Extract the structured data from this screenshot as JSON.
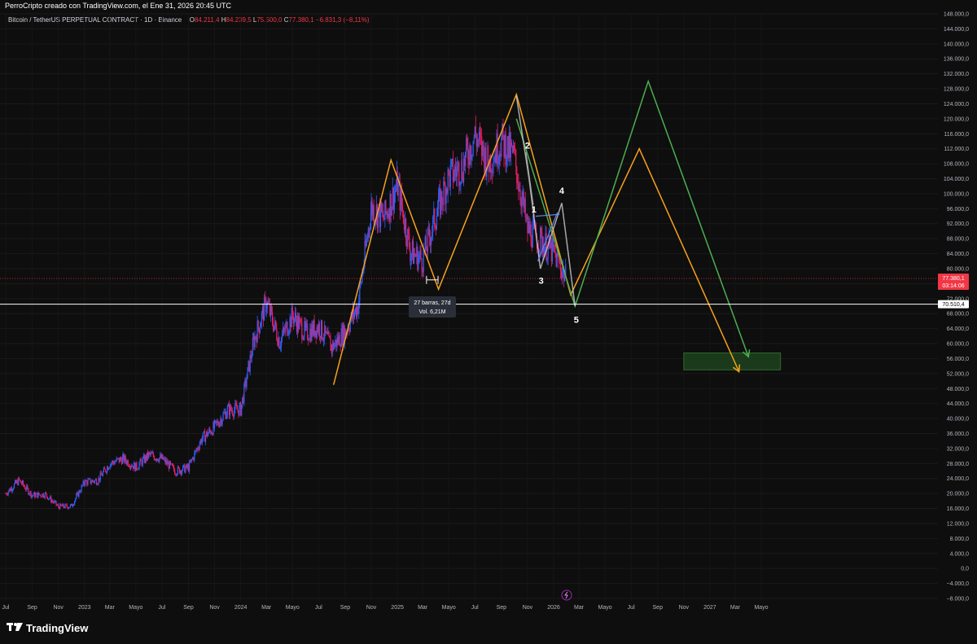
{
  "header": {
    "creator_text": "PerroCripto creado con TradingView.com, el Ene 31, 2026 20:45 UTC"
  },
  "legend": {
    "symbol": "Bitcoin / TetherUS PERPETUAL CONTRACT · 1D · Binance",
    "open_label": "O",
    "open": "84.211,4",
    "high_label": "H",
    "high": "84.239,5",
    "low_label": "L",
    "low": "75.500,0",
    "close_label": "C",
    "close": "77.380,1",
    "change": "−6.831,3 (−8,11%)"
  },
  "price_badge": {
    "price": "77.380,1",
    "countdown": "03:14:06",
    "color": "#f23645"
  },
  "line_badge": {
    "price": "70.510,4"
  },
  "range_tooltip": {
    "bars": "27 barras, 27d",
    "volume": "Vol. 6,21M"
  },
  "wave_labels": [
    "1",
    "2",
    "3",
    "4",
    "5"
  ],
  "brand": {
    "name": "TradingView"
  },
  "colors": {
    "background": "#0e0e0e",
    "candle_up": "#2962ff",
    "candle_down": "#e91e63",
    "orange_path": "#f7a21b",
    "green_path": "#4caf50",
    "target_zone": "#1b3a1b"
  },
  "chart_data": {
    "type": "candlestick",
    "title": "Bitcoin / TetherUS PERPETUAL CONTRACT · 1D · Binance",
    "ylim": [
      -8000,
      148000
    ],
    "y_ticks": [
      148000,
      144000,
      140000,
      136000,
      132000,
      128000,
      124000,
      120000,
      116000,
      112000,
      108000,
      104000,
      100000,
      96000,
      92000,
      88000,
      84000,
      80000,
      76000,
      72000,
      68000,
      64000,
      60000,
      56000,
      52000,
      48000,
      44000,
      40000,
      36000,
      32000,
      28000,
      24000,
      20000,
      16000,
      12000,
      8000,
      4000,
      0,
      -4000,
      -8000
    ],
    "y_tick_labels": [
      "148.000,0",
      "144.000,0",
      "140.000,0",
      "136.000,0",
      "132.000,0",
      "128.000,0",
      "124.000,0",
      "120.000,0",
      "116.000,0",
      "112.000,0",
      "108.000,0",
      "104.000,0",
      "100.000,0",
      "96.000,0",
      "92.000,0",
      "88.000,0",
      "84.000,0",
      "80.000,0",
      "76.000,0",
      "72.000,0",
      "68.000,0",
      "64.000,0",
      "60.000,0",
      "56.000,0",
      "52.000,0",
      "48.000,0",
      "44.000,0",
      "40.000,0",
      "36.000,0",
      "32.000,0",
      "28.000,0",
      "24.000,0",
      "20.000,0",
      "16.000,0",
      "12.000,0",
      "8.000,0",
      "4.000,0",
      "0,0",
      "−4.000,0",
      "−8.000,0"
    ],
    "x_tick_labels": [
      "Jul",
      "Sep",
      "Nov",
      "2023",
      "Mar",
      "Mayo",
      "Jul",
      "Sep",
      "Nov",
      "2024",
      "Mar",
      "Mayo",
      "Jul",
      "Sep",
      "Nov",
      "2025",
      "Mar",
      "Mayo",
      "Jul",
      "Sep",
      "Nov",
      "2026",
      "Mar",
      "Mayo",
      "Jul",
      "Sep",
      "Nov",
      "2027",
      "Mar",
      "Mayo"
    ],
    "x_tick_dates": [
      "2022-07",
      "2022-09",
      "2022-11",
      "2023-01",
      "2023-03",
      "2023-05",
      "2023-07",
      "2023-09",
      "2023-11",
      "2024-01",
      "2024-03",
      "2024-05",
      "2024-07",
      "2024-09",
      "2024-11",
      "2025-01",
      "2025-03",
      "2025-05",
      "2025-07",
      "2025-09",
      "2025-11",
      "2026-01",
      "2026-03",
      "2026-05",
      "2026-07",
      "2026-09",
      "2026-11",
      "2027-01",
      "2027-03",
      "2027-05"
    ],
    "price_path": [
      [
        "2022-07",
        20000
      ],
      [
        "2022-08",
        23500
      ],
      [
        "2022-09",
        19500
      ],
      [
        "2022-10",
        19800
      ],
      [
        "2022-11",
        16500
      ],
      [
        "2022-12",
        16600
      ],
      [
        "2023-01",
        23000
      ],
      [
        "2023-02",
        23500
      ],
      [
        "2023-03",
        28000
      ],
      [
        "2023-04",
        29300
      ],
      [
        "2023-05",
        27000
      ],
      [
        "2023-06",
        30300
      ],
      [
        "2023-07",
        29300
      ],
      [
        "2023-08",
        26000
      ],
      [
        "2023-09",
        26900
      ],
      [
        "2023-10",
        34500
      ],
      [
        "2023-11",
        37700
      ],
      [
        "2023-12",
        42300
      ],
      [
        "2024-01",
        42500
      ],
      [
        "2024-02",
        61000
      ],
      [
        "2024-03",
        71000
      ],
      [
        "2024-04",
        60500
      ],
      [
        "2024-05",
        67500
      ],
      [
        "2024-06",
        62700
      ],
      [
        "2024-07",
        64600
      ],
      [
        "2024-08",
        59000
      ],
      [
        "2024-09",
        63300
      ],
      [
        "2024-10",
        70200
      ],
      [
        "2024-11",
        96400
      ],
      [
        "2024-12",
        93400
      ],
      [
        "2025-01",
        102400
      ],
      [
        "2025-02",
        84300
      ],
      [
        "2025-03",
        82500
      ],
      [
        "2025-04",
        94200
      ],
      [
        "2025-05",
        104600
      ],
      [
        "2025-06",
        107100
      ],
      [
        "2025-07",
        115700
      ],
      [
        "2025-08",
        108200
      ],
      [
        "2025-09",
        114000
      ],
      [
        "2025-10",
        109600
      ],
      [
        "2025-11",
        90400
      ],
      [
        "2025-12",
        87500
      ],
      [
        "2026-01",
        84200
      ],
      [
        "2026-01-31",
        77380
      ]
    ],
    "last_price": 77380.1,
    "horizontal_line": 70510.4,
    "target_zone": {
      "from": "2026-11-01",
      "to": "2027-06-15",
      "low": 53000,
      "high": 57500
    },
    "orange_path": [
      [
        "2024-08-05",
        49000
      ],
      [
        "2024-12-17",
        109000
      ],
      [
        "2025-04-07",
        74500
      ],
      [
        "2025-10-06",
        126500
      ],
      [
        "2026-02-10",
        73000
      ],
      [
        "2026-07-20",
        112000
      ],
      [
        "2027-03-10",
        52500
      ]
    ],
    "green_path": [
      [
        "2025-10-06",
        120000
      ],
      [
        "2026-02-20",
        70000
      ],
      [
        "2026-08-10",
        130000
      ],
      [
        "2027-04-01",
        56500
      ]
    ],
    "wave_points": [
      [
        "1",
        "2025-11-20",
        97000
      ],
      [
        "2",
        "2025-10-20",
        112000
      ],
      [
        "3",
        "2025-12-01",
        80000
      ],
      [
        "4",
        "2026-01-20",
        97500
      ],
      [
        "5",
        "2026-02-20",
        68000
      ]
    ]
  }
}
